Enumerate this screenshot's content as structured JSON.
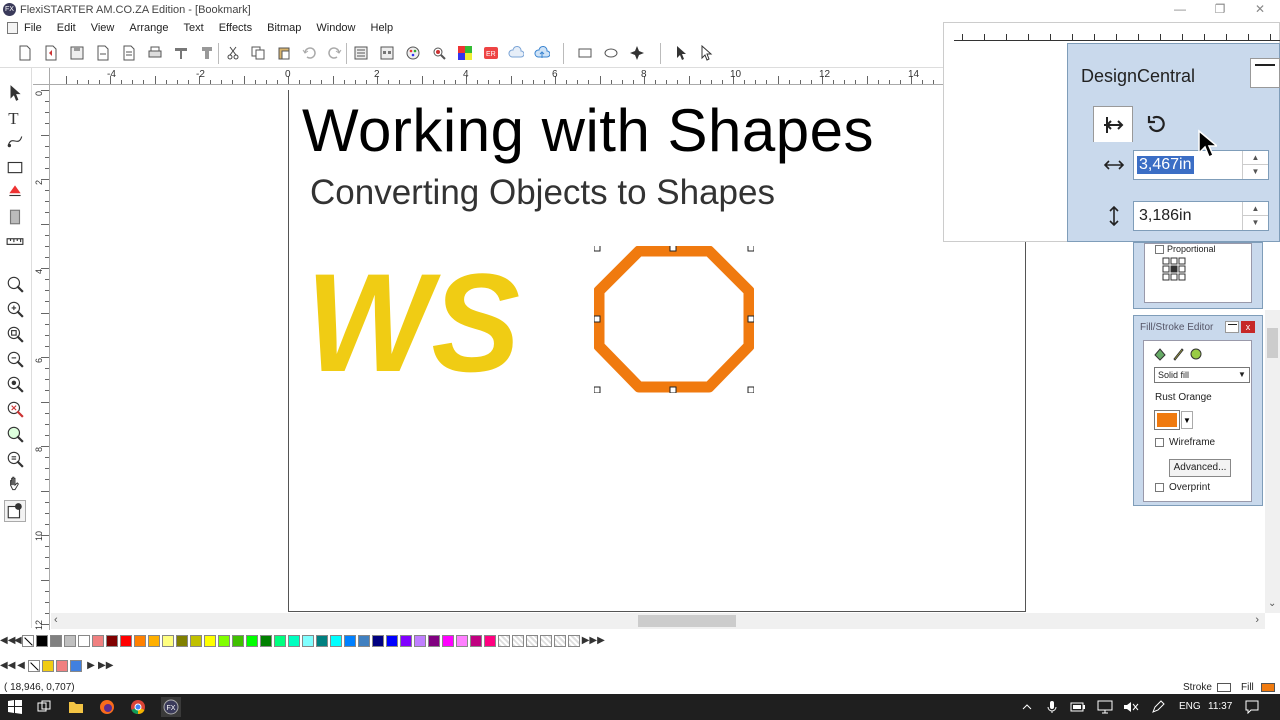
{
  "window": {
    "title": "FlexiSTARTER AM.CO.ZA Edition - [Bookmark]",
    "app_icon_text": "FX"
  },
  "menu": [
    "File",
    "Edit",
    "View",
    "Arrange",
    "Text",
    "Effects",
    "Bitmap",
    "Window",
    "Help"
  ],
  "ruler": {
    "horizontal_labels": [
      "-4",
      "-2",
      "0",
      "2",
      "4",
      "6",
      "8",
      "10",
      "12",
      "14"
    ],
    "vertical_labels": [
      "0",
      "2",
      "4",
      "6",
      "8",
      "10",
      "12"
    ]
  },
  "document": {
    "heading": "Working with Shapes",
    "subheading": "Converting Objects to Shapes",
    "logo_text": "WS",
    "logo_color": "#f0cc14",
    "shape_stroke_color": "#f07a0f"
  },
  "design_central": {
    "title": "DesignCentral",
    "width_value": "3,467in",
    "height_value": "3,186in",
    "proportional_label": "Proportional"
  },
  "fill_stroke_editor": {
    "title": "Fill/Stroke Editor",
    "fill_type": "Solid fill",
    "color_name": "Rust Orange",
    "color_hex": "#f07a0f",
    "wireframe_label": "Wireframe",
    "advanced_label": "Advanced...",
    "overprint_label": "Overprint",
    "close_label": "x"
  },
  "palette": {
    "row1": [
      "#000000",
      "#808080",
      "#c0c0c0",
      "#ffffff",
      "#f08080",
      "#800000",
      "#ff0000",
      "#ff8000",
      "#ffb000",
      "#ffff80",
      "#808000",
      "#c0c000",
      "#ffff00",
      "#80ff00",
      "#40c000",
      "#00ff00",
      "#008000",
      "#00ff80",
      "#00ffc0",
      "#80ffff",
      "#008080",
      "#00ffff",
      "#0080ff",
      "#4080c0",
      "#000080",
      "#0000ff",
      "#8000ff",
      "#c080ff",
      "#800080",
      "#ff00ff",
      "#ff80ff",
      "#c00080",
      "#ff0080"
    ],
    "row2": [
      "#f0cc14",
      "#f08080",
      "#4080e0"
    ]
  },
  "status": {
    "coords": "( 18,946,    0,707)",
    "stroke_label": "Stroke",
    "fill_label": "Fill"
  },
  "taskbar": {
    "lang": "ENG",
    "time": "11:37"
  }
}
